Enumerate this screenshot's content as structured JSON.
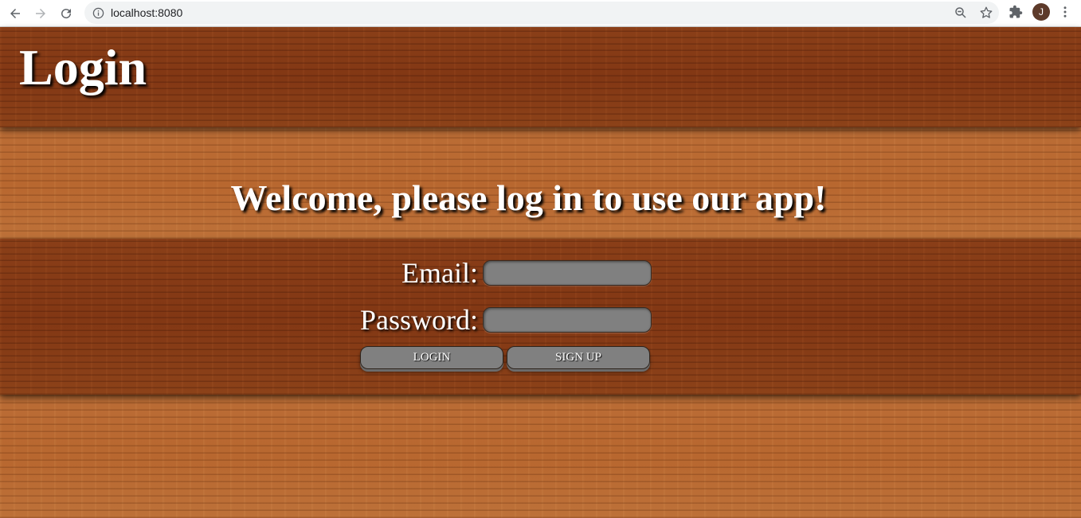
{
  "browser": {
    "url": "localhost:8080",
    "avatar_letter": "J",
    "icons": {
      "back": "arrow-left-icon",
      "forward": "arrow-right-icon",
      "reload": "reload-icon",
      "info": "info-icon",
      "zoom": "zoom-icon",
      "bookmark": "star-icon",
      "extensions": "puzzle-icon",
      "menu": "kebab-menu-icon"
    }
  },
  "header": {
    "title": "Login"
  },
  "main": {
    "welcome": "Welcome, please log in to use our app!",
    "form": {
      "email_label": "Email:",
      "email_value": "",
      "password_label": "Password:",
      "password_value": "",
      "login_button": "LOGIN",
      "signup_button": "SIGN UP"
    }
  },
  "colors": {
    "wood_light": "#bb6d36",
    "wood_dark": "#853a16",
    "field_bg": "#808080",
    "text": "#ffffff"
  }
}
